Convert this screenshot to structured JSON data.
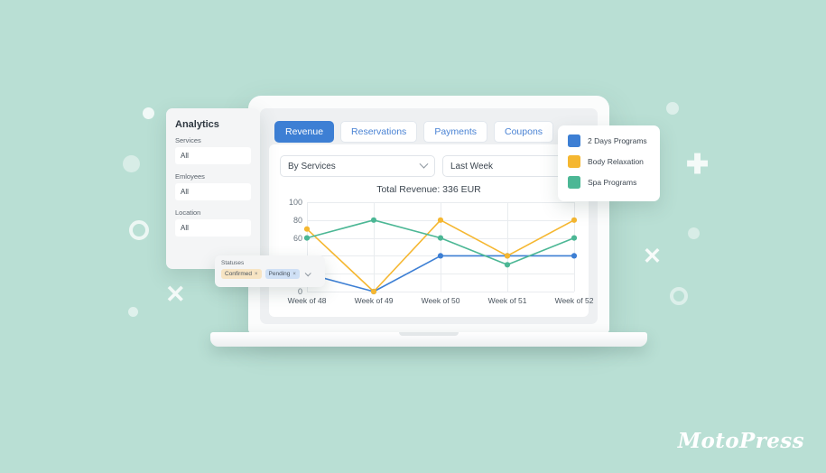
{
  "background": {
    "color": "#b9dfd4"
  },
  "brand": {
    "name": "MotoPress"
  },
  "sidebar": {
    "title": "Analytics",
    "fields": [
      {
        "label": "Services",
        "value": "All"
      },
      {
        "label": "Emloyees",
        "value": "All"
      },
      {
        "label": "Location",
        "value": "All"
      }
    ]
  },
  "statuses": {
    "label": "Statuses",
    "chips": [
      {
        "label": "Confirmed",
        "remove": "×",
        "color": "#f7e4c3"
      },
      {
        "label": "Pending",
        "remove": "×",
        "color": "#cfe0f5"
      }
    ]
  },
  "tabs": [
    {
      "label": "Revenue",
      "active": true
    },
    {
      "label": "Reservations",
      "active": false
    },
    {
      "label": "Payments",
      "active": false
    },
    {
      "label": "Coupons",
      "active": false
    }
  ],
  "filters": {
    "group_by": {
      "value": "By Services",
      "placeholder": "By Services"
    },
    "period": {
      "value": "Last Week",
      "placeholder": "Last Week"
    }
  },
  "legend": [
    {
      "label": "2 Days Programs",
      "color": "#3d7fd4"
    },
    {
      "label": "Body Relaxation",
      "color": "#f5b731"
    },
    {
      "label": "Spa Programs",
      "color": "#4cb795"
    }
  ],
  "chart_data": {
    "type": "line",
    "title": "Total Revenue: 336 EUR",
    "xlabel": "",
    "ylabel": "",
    "categories": [
      "Week of 48",
      "Week of 49",
      "Week of 50",
      "Week of 51",
      "Week of 52"
    ],
    "ylim": [
      0,
      100
    ],
    "yticks": [
      0,
      20,
      40,
      60,
      80,
      100
    ],
    "ytick_labels": [
      "0",
      "",
      "",
      "60",
      "80",
      "100"
    ],
    "grid": true,
    "legend_position": "right",
    "series": [
      {
        "name": "2 Days Programs",
        "color": "#3d7fd4",
        "values": [
          20,
          0,
          40,
          40,
          40
        ]
      },
      {
        "name": "Body Relaxation",
        "color": "#f5b731",
        "values": [
          70,
          0,
          80,
          40,
          80
        ]
      },
      {
        "name": "Spa Programs",
        "color": "#4cb795",
        "values": [
          60,
          80,
          60,
          30,
          60
        ]
      }
    ]
  }
}
